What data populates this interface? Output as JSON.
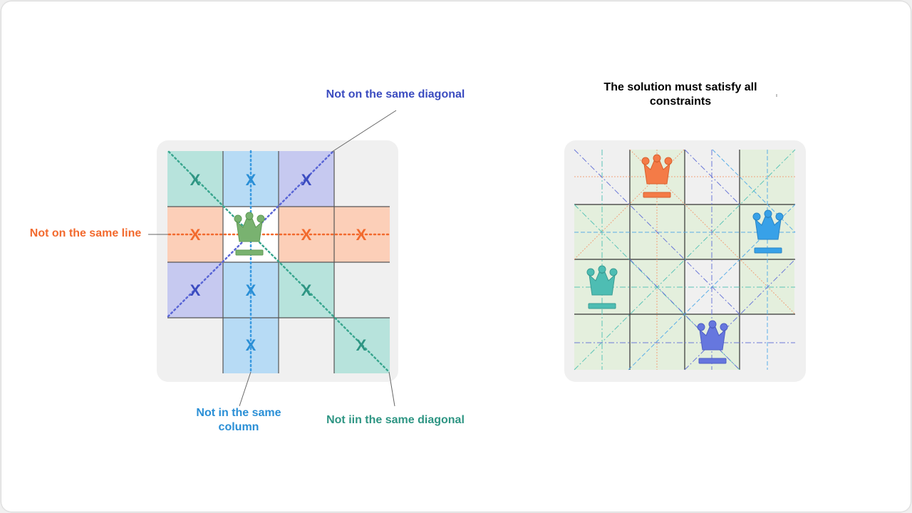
{
  "labels": {
    "diag_top": "Not on the same diagonal",
    "line": "Not on the same line",
    "column": "Not in the same column",
    "diag_bottom": "Not iin the same diagonal",
    "solution": "The solution must satisfy all constraints"
  },
  "mark": "X",
  "colors": {
    "orange": "#f26a2e",
    "blue_column": "#2a8fd6",
    "indigo": "#3b4cc0",
    "teal": "#2e9583",
    "queen_green": "#79b270",
    "queen_orange": "#f47b47",
    "queen_blue": "#38a1e8",
    "queen_teal": "#4ebdb3",
    "queen_indigo": "#6677de"
  }
}
